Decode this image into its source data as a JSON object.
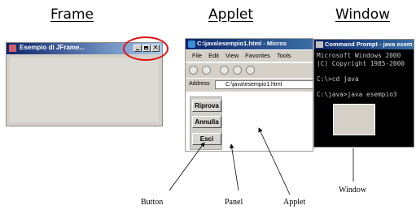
{
  "headings": {
    "frame": "Frame",
    "applet": "Applet",
    "window": "Window"
  },
  "frame": {
    "title": "Esempio di JFrame...",
    "controls": [
      "_",
      "□",
      "×"
    ]
  },
  "browser": {
    "title": "C:\\java\\esempio1.html - Micros",
    "menus": [
      "File",
      "Edit",
      "View",
      "Favorites",
      "Tools"
    ],
    "address_label": "Address",
    "address_value": "C:\\java\\esempio1.html",
    "buttons": [
      "Riprova",
      "Annulla",
      "Esci"
    ]
  },
  "console": {
    "title": "Command Prompt - java esem",
    "lines": [
      "Microsoft Windows 2000",
      "(C) Copyright 1985-2000",
      "",
      "C:\\>cd java",
      "",
      "C:\\java>java esempio3"
    ]
  },
  "captions": {
    "button": "Button",
    "panel": "Panel",
    "applet": "Applet",
    "window": "Window"
  }
}
